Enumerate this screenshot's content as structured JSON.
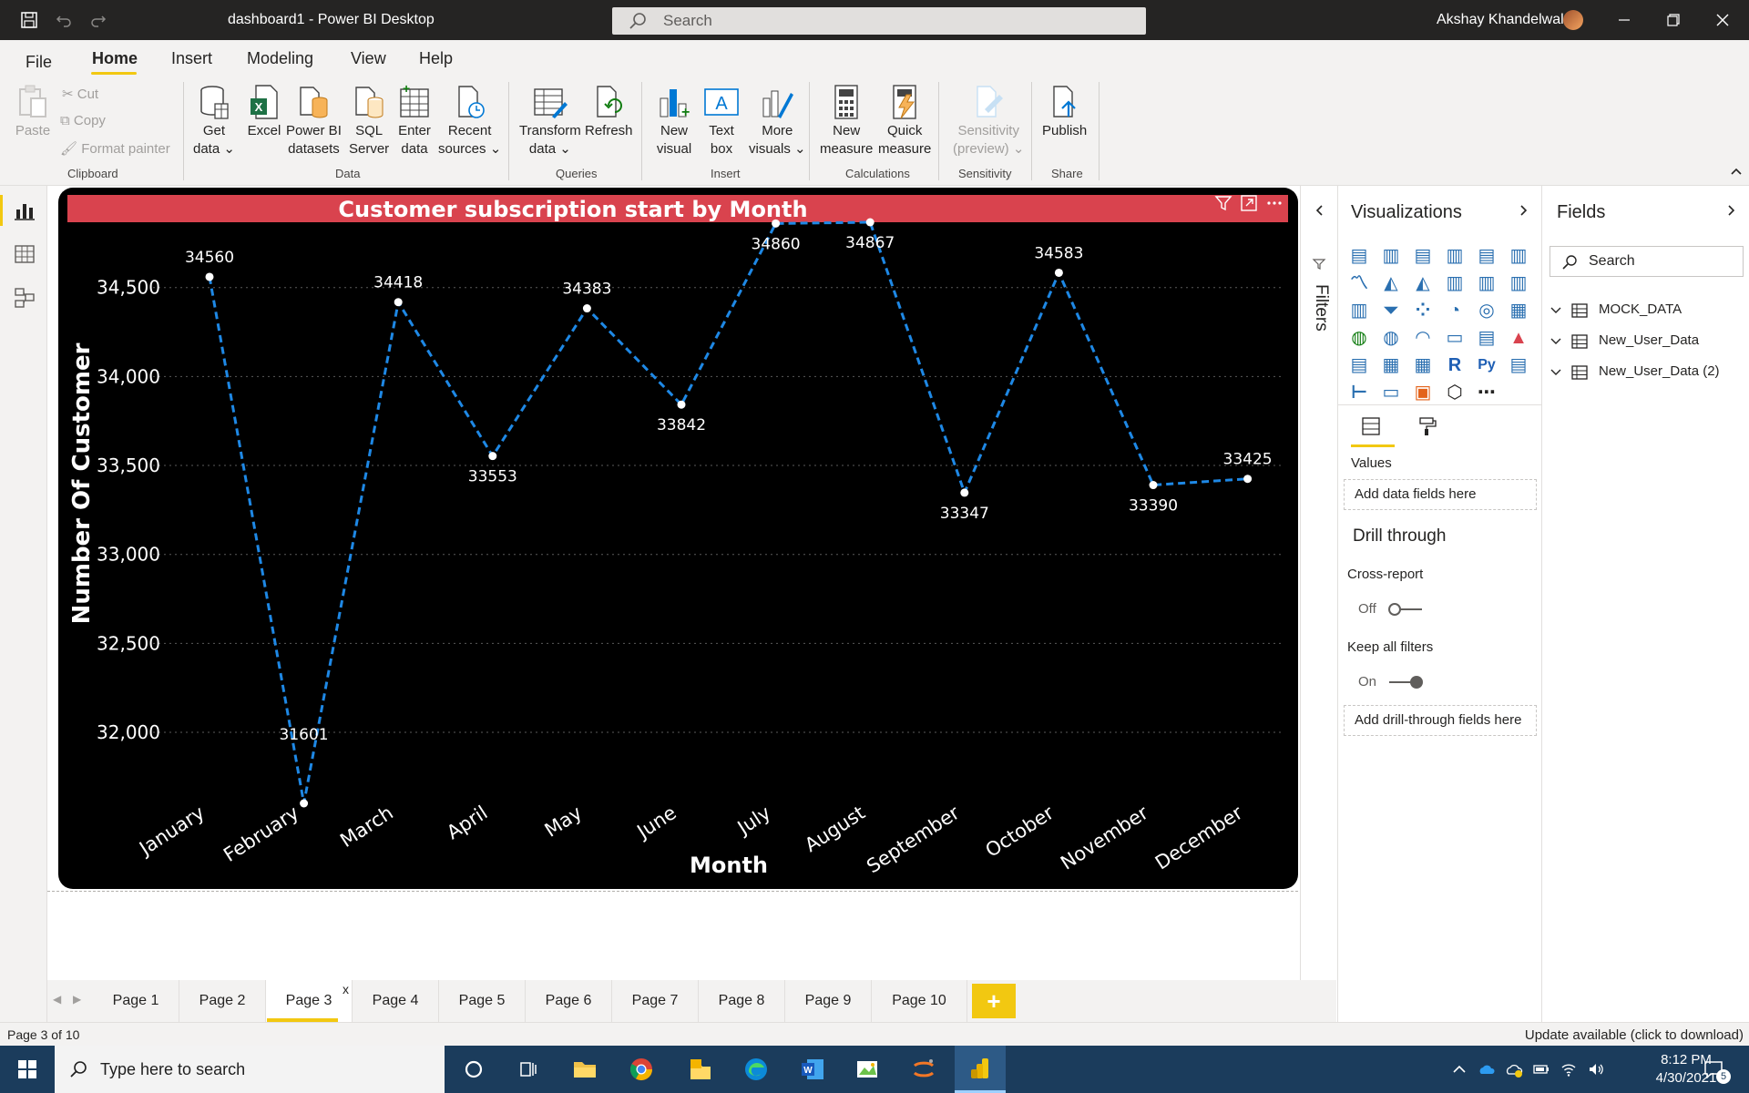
{
  "window": {
    "title": "dashboard1 - Power BI Desktop",
    "search_placeholder": "Search",
    "user_name": "Akshay Khandelwal"
  },
  "menu": {
    "file": "File",
    "home": "Home",
    "insert": "Insert",
    "modeling": "Modeling",
    "view": "View",
    "help": "Help"
  },
  "ribbon": {
    "clipboard": {
      "paste": "Paste",
      "cut": "Cut",
      "copy": "Copy",
      "format_painter": "Format painter",
      "group": "Clipboard"
    },
    "data": {
      "get_data": "Get\ndata ⌄",
      "excel": "Excel",
      "pbi_datasets": "Power BI\ndatasets",
      "sql_server": "SQL\nServer",
      "enter_data": "Enter\ndata",
      "recent_sources": "Recent\nsources ⌄",
      "group": "Data"
    },
    "queries": {
      "transform": "Transform\ndata ⌄",
      "refresh": "Refresh",
      "group": "Queries"
    },
    "insert": {
      "new_visual": "New\nvisual",
      "text_box": "Text\nbox",
      "more_visuals": "More\nvisuals ⌄",
      "group": "Insert"
    },
    "calculations": {
      "new_measure": "New\nmeasure",
      "quick_measure": "Quick\nmeasure",
      "group": "Calculations"
    },
    "sensitivity": {
      "sensitivity": "Sensitivity\n(preview) ⌄",
      "group": "Sensitivity"
    },
    "share": {
      "publish": "Publish",
      "group": "Share"
    }
  },
  "filters_pane": {
    "label": "Filters"
  },
  "visualizations": {
    "title": "Visualizations",
    "values_label": "Values",
    "values_placeholder": "Add data fields here",
    "drill_through_title": "Drill through",
    "cross_report_label": "Cross-report",
    "cross_report_state": "Off",
    "keep_filters_label": "Keep all filters",
    "keep_filters_state": "On",
    "drill_placeholder": "Add drill-through fields here"
  },
  "fields": {
    "title": "Fields",
    "search_placeholder": "Search",
    "tables": [
      "MOCK_DATA",
      "New_User_Data",
      "New_User_Data (2)"
    ]
  },
  "pages": {
    "tabs": [
      "Page 1",
      "Page 2",
      "Page 3",
      "Page 4",
      "Page 5",
      "Page 6",
      "Page 7",
      "Page 8",
      "Page 9",
      "Page 10"
    ],
    "active_index": 2,
    "close_glyph": "x",
    "add_glyph": "+"
  },
  "status": {
    "left": "Page 3 of 10",
    "right": "Update available (click to download)"
  },
  "taskbar": {
    "search_placeholder": "Type here to search",
    "time": "8:12 PM",
    "date": "4/30/2021",
    "notification_count": "5"
  },
  "colors": {
    "accent": "#f2c811",
    "chart_title_bg": "#d9434e",
    "chart_bg": "#000000",
    "line": "#1e88e5",
    "taskbar": "#1b3c5c"
  },
  "chart_data": {
    "type": "line",
    "title": "Customer subscription start by Month",
    "xlabel": "Month",
    "ylabel": "Number Of Customer",
    "categories": [
      "January",
      "February",
      "March",
      "April",
      "May",
      "June",
      "July",
      "August",
      "September",
      "October",
      "November",
      "December"
    ],
    "values": [
      34560,
      31601,
      34418,
      33553,
      34383,
      33842,
      34860,
      34867,
      33347,
      34583,
      33390,
      33425
    ],
    "value_labels": [
      "34560",
      "31601",
      "34418",
      "33553",
      "34383",
      "33842",
      "34860",
      "34867",
      "33347",
      "34583",
      "33390",
      "33425"
    ],
    "y_ticks": [
      32000,
      32500,
      33000,
      33500,
      34000,
      34500
    ],
    "y_tick_labels": [
      "32,000",
      "32,500",
      "33,000",
      "33,500",
      "34,000",
      "34,500"
    ],
    "ylim": [
      31601,
      34867
    ],
    "grid": true,
    "line_style": "dashed"
  }
}
